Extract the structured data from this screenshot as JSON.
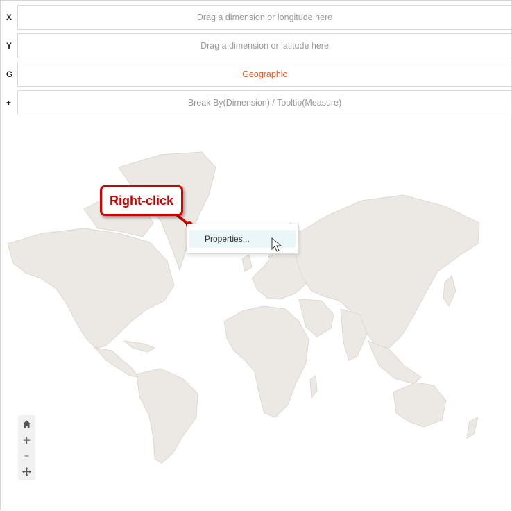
{
  "shelves": [
    {
      "key": "X",
      "placeholder": "Drag a dimension or longitude here",
      "filled": false
    },
    {
      "key": "Y",
      "placeholder": "Drag a dimension or latitude here",
      "filled": false
    },
    {
      "key": "G",
      "placeholder": "Geographic",
      "filled": true
    },
    {
      "key": "+",
      "placeholder": "Break By(Dimension) / Tooltip(Measure)",
      "filled": false
    }
  ],
  "context_menu": {
    "items": [
      {
        "label": "Properties..."
      }
    ]
  },
  "callout": {
    "label": "Right-click",
    "color": "#d40000"
  },
  "map_controls": {
    "home_icon": "home-icon",
    "zoom_in_label": "+",
    "zoom_out_label": "–",
    "pan_icon": "pan-icon"
  },
  "colors": {
    "geographic": "#e05a2a",
    "land": "#ece9e4",
    "land_border": "#dcd8d2",
    "menu_highlight": "#eaf6f8"
  }
}
